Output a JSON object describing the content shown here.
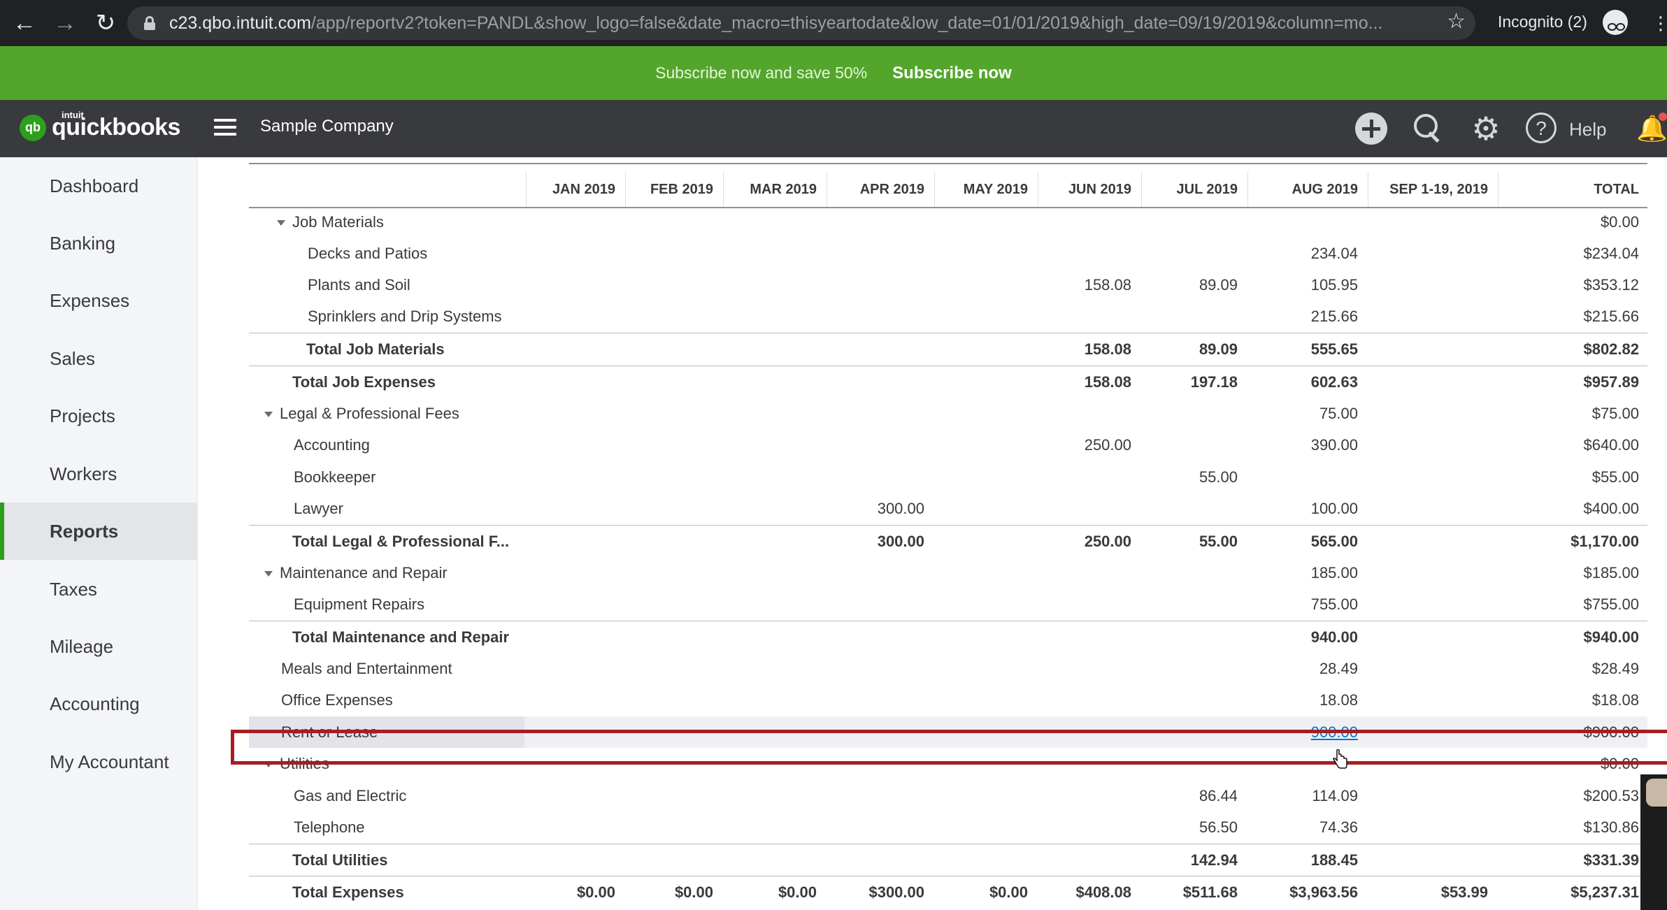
{
  "browser": {
    "url_host": "c23.qbo.intuit.com",
    "url_path": "/app/reportv2?token=PANDL&show_logo=false&date_macro=thisyeartodate&low_date=01/01/2019&high_date=09/19/2019&column=mo...",
    "incognito_label": "Incognito (2)"
  },
  "promo": {
    "text": "Subscribe now and save 50%",
    "button": "Subscribe now"
  },
  "header": {
    "logo_intuit": "intuit",
    "logo_text": "quickbooks",
    "logo_badge": "qb",
    "company": "Sample Company",
    "help_label": "Help",
    "help_glyph": "?"
  },
  "sidebar": {
    "items": [
      {
        "label": "Dashboard",
        "active": false
      },
      {
        "label": "Banking",
        "active": false
      },
      {
        "label": "Expenses",
        "active": false
      },
      {
        "label": "Sales",
        "active": false
      },
      {
        "label": "Projects",
        "active": false
      },
      {
        "label": "Workers",
        "active": false
      },
      {
        "label": "Reports",
        "active": true
      },
      {
        "label": "Taxes",
        "active": false
      },
      {
        "label": "Mileage",
        "active": false
      },
      {
        "label": "Accounting",
        "active": false
      },
      {
        "label": "My Accountant",
        "active": false
      }
    ]
  },
  "report": {
    "columns": [
      "JAN 2019",
      "FEB 2019",
      "MAR 2019",
      "APR 2019",
      "MAY 2019",
      "JUN 2019",
      "JUL 2019",
      "AUG 2019",
      "SEP 1-19, 2019",
      "TOTAL"
    ],
    "rows": [
      {
        "label": "Job Materials",
        "level": 2,
        "collapsible": true,
        "total": false,
        "values": [
          "",
          "",
          "",
          "",
          "",
          "",
          "",
          "",
          "",
          "$0.00"
        ]
      },
      {
        "label": "Decks and Patios",
        "level": 3,
        "total": false,
        "values": [
          "",
          "",
          "",
          "",
          "",
          "",
          "",
          "234.04",
          "",
          "$234.04"
        ]
      },
      {
        "label": "Plants and Soil",
        "level": 3,
        "total": false,
        "values": [
          "",
          "",
          "",
          "",
          "",
          "158.08",
          "89.09",
          "105.95",
          "",
          "$353.12"
        ]
      },
      {
        "label": "Sprinklers and Drip Systems",
        "level": 3,
        "total": false,
        "values": [
          "",
          "",
          "",
          "",
          "",
          "",
          "",
          "215.66",
          "",
          "$215.66"
        ]
      },
      {
        "label": "Total Job Materials",
        "level": 3,
        "total": true,
        "values": [
          "",
          "",
          "",
          "",
          "",
          "158.08",
          "89.09",
          "555.65",
          "",
          "$802.82"
        ]
      },
      {
        "label": "Total Job Expenses",
        "level": 2,
        "total": true,
        "values": [
          "",
          "",
          "",
          "",
          "",
          "158.08",
          "197.18",
          "602.63",
          "",
          "$957.89"
        ]
      },
      {
        "label": "Legal & Professional Fees",
        "level": 1,
        "collapsible": true,
        "total": false,
        "values": [
          "",
          "",
          "",
          "",
          "",
          "",
          "",
          "75.00",
          "",
          "$75.00"
        ]
      },
      {
        "label": "Accounting",
        "level": 2,
        "total": false,
        "values": [
          "",
          "",
          "",
          "",
          "",
          "250.00",
          "",
          "390.00",
          "",
          "$640.00"
        ]
      },
      {
        "label": "Bookkeeper",
        "level": 2,
        "total": false,
        "values": [
          "",
          "",
          "",
          "",
          "",
          "",
          "55.00",
          "",
          "",
          "$55.00"
        ]
      },
      {
        "label": "Lawyer",
        "level": 2,
        "total": false,
        "values": [
          "",
          "",
          "",
          "300.00",
          "",
          "",
          "",
          "100.00",
          "",
          "$400.00"
        ]
      },
      {
        "label": "Total Legal & Professional F...",
        "level": 2,
        "total": true,
        "values": [
          "",
          "",
          "",
          "300.00",
          "",
          "250.00",
          "55.00",
          "565.00",
          "",
          "$1,170.00"
        ]
      },
      {
        "label": "Maintenance and Repair",
        "level": 1,
        "collapsible": true,
        "total": false,
        "values": [
          "",
          "",
          "",
          "",
          "",
          "",
          "",
          "185.00",
          "",
          "$185.00"
        ]
      },
      {
        "label": "Equipment Repairs",
        "level": 2,
        "total": false,
        "values": [
          "",
          "",
          "",
          "",
          "",
          "",
          "",
          "755.00",
          "",
          "$755.00"
        ]
      },
      {
        "label": "Total Maintenance and Repair",
        "level": 2,
        "total": true,
        "values": [
          "",
          "",
          "",
          "",
          "",
          "",
          "",
          "940.00",
          "",
          "$940.00"
        ]
      },
      {
        "label": "Meals and Entertainment",
        "level": 1,
        "total": false,
        "values": [
          "",
          "",
          "",
          "",
          "",
          "",
          "",
          "28.49",
          "",
          "$28.49"
        ]
      },
      {
        "label": "Office Expenses",
        "level": 1,
        "total": false,
        "values": [
          "",
          "",
          "",
          "",
          "",
          "",
          "",
          "18.08",
          "",
          "$18.08"
        ]
      },
      {
        "label": "Rent or Lease",
        "level": 1,
        "total": false,
        "highlighted": true,
        "values": [
          "",
          "",
          "",
          "",
          "",
          "",
          "",
          "900.00",
          "",
          "$900.00"
        ]
      },
      {
        "label": "Utilities",
        "level": 1,
        "collapsible": true,
        "total": false,
        "values": [
          "",
          "",
          "",
          "",
          "",
          "",
          "",
          "",
          "",
          "$0.00"
        ]
      },
      {
        "label": "Gas and Electric",
        "level": 2,
        "total": false,
        "values": [
          "",
          "",
          "",
          "",
          "",
          "",
          "86.44",
          "114.09",
          "",
          "$200.53"
        ]
      },
      {
        "label": "Telephone",
        "level": 2,
        "total": false,
        "values": [
          "",
          "",
          "",
          "",
          "",
          "",
          "56.50",
          "74.36",
          "",
          "$130.86"
        ]
      },
      {
        "label": "Total Utilities",
        "level": 2,
        "total": true,
        "values": [
          "",
          "",
          "",
          "",
          "",
          "",
          "142.94",
          "188.45",
          "",
          "$331.39"
        ]
      },
      {
        "label": "Total Expenses",
        "level": 1,
        "total": true,
        "partial": true,
        "values": [
          "$0.00",
          "$0.00",
          "$0.00",
          "$300.00",
          "$0.00",
          "$408.08",
          "$511.68",
          "$3,963.56",
          "$53.99",
          "$5,237.31"
        ]
      }
    ]
  },
  "colors": {
    "promo_green": "#53a62b",
    "header_dark": "#393a3d",
    "active_accent": "#2ca01c",
    "highlight_box": "#a61d24",
    "link_blue": "#0077c5"
  }
}
